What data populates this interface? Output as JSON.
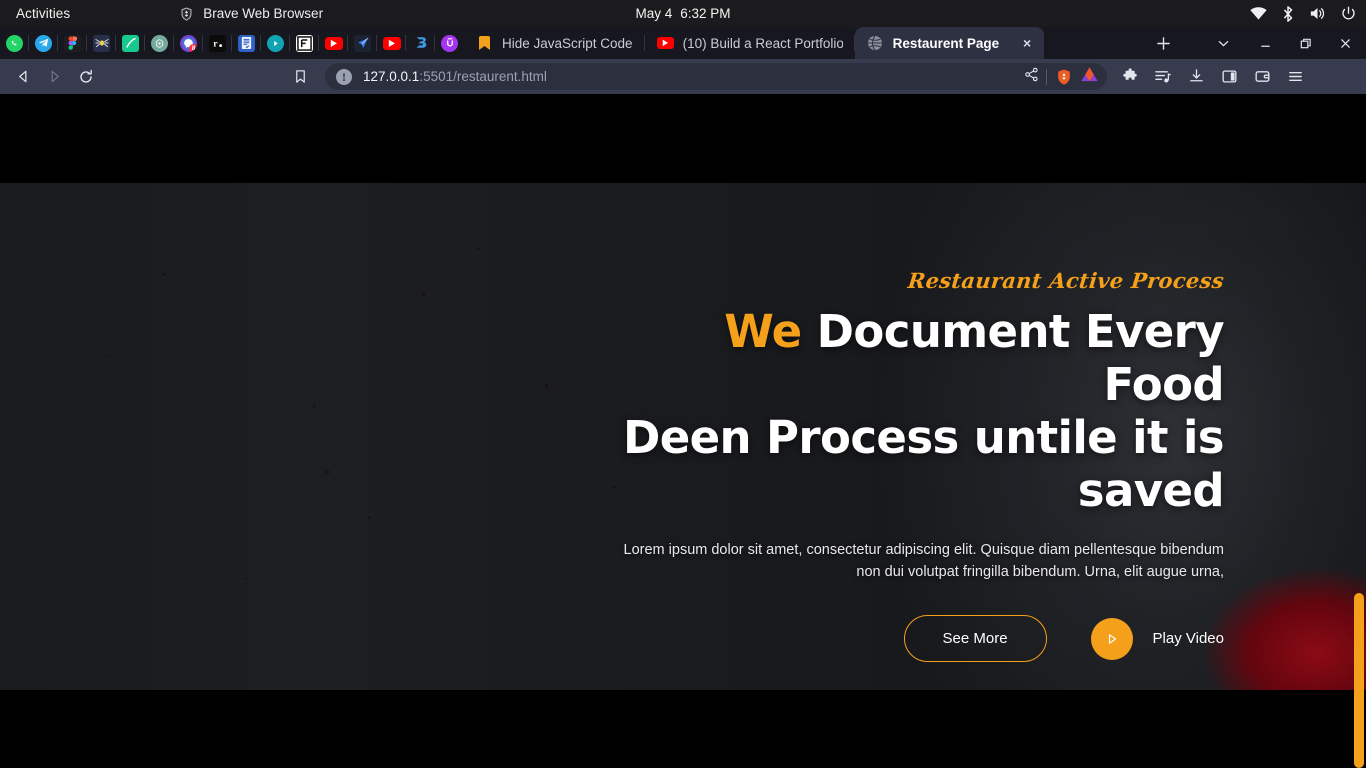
{
  "os_bar": {
    "activities": "Activities",
    "app_name": "Brave Web Browser",
    "app_icon": "brave-lion-icon",
    "date": "May 4",
    "time": "6:32 PM",
    "tray_icons": [
      "wifi-icon",
      "bluetooth-icon",
      "volume-icon",
      "power-icon"
    ]
  },
  "browser": {
    "pinned_tabs": [
      {
        "name": "whatsapp",
        "icon": "whatsapp-icon",
        "color": "#25D366"
      },
      {
        "name": "telegram",
        "icon": "telegram-icon",
        "color": "#29A9EB"
      },
      {
        "name": "figma",
        "icon": "figma-icon",
        "color": "#1e1e1e"
      },
      {
        "name": "spider",
        "icon": "bug-icon",
        "color": "#26304a"
      },
      {
        "name": "tick",
        "icon": "swoosh-icon",
        "color": "#17c98c"
      },
      {
        "name": "chatgpt",
        "icon": "openai-icon",
        "color": "#74aa9c"
      },
      {
        "name": "messenger",
        "icon": "messenger-badge-icon",
        "color": "#0084FF",
        "badge": "8"
      },
      {
        "name": "rapid",
        "icon": "r-dot-icon",
        "color": "#0b0b0b"
      },
      {
        "name": "notes",
        "icon": "notebook-icon",
        "color": "#2f62c4"
      },
      {
        "name": "player",
        "icon": "play-circle-icon",
        "color": "#12a3b4"
      },
      {
        "name": "flaticon",
        "icon": "f-frame-icon",
        "color": "#ffffff"
      },
      {
        "name": "youtube-1",
        "icon": "youtube-icon",
        "color": "#FF0000"
      },
      {
        "name": "arrow",
        "icon": "paper-plane-icon",
        "color": "#1c2333"
      },
      {
        "name": "youtube-2",
        "icon": "youtube-icon",
        "color": "#FF0000"
      },
      {
        "name": "bootstrap",
        "icon": "bootstrap-icon",
        "color": "#2f9ae0"
      },
      {
        "name": "udemy",
        "icon": "u-circle-icon",
        "color": "#a435f0"
      }
    ],
    "tabs": [
      {
        "title": "Hide JavaScript Code",
        "icon": "bookmark-tag-icon",
        "active": false
      },
      {
        "title": "(10) Build a React Portfolio",
        "icon": "youtube-icon",
        "active": false
      },
      {
        "title": "Restaurent Page",
        "icon": "globe-icon",
        "active": true
      }
    ],
    "tab_close_label": "×",
    "new_tab_label": "+",
    "tab_list_icon": "chevron-down-icon",
    "window_controls": [
      "minimize-icon",
      "restore-icon",
      "close-icon"
    ],
    "nav": {
      "back": "back-arrow-icon",
      "forward": "forward-arrow-icon",
      "reload": "reload-icon",
      "bookmark": "bookmark-icon"
    },
    "omnibox": {
      "info_icon": "not-secure-info-icon",
      "info_glyph": "!",
      "url_host": "127.0.0.1",
      "url_path": ":5501/restaurent.html",
      "share_icon": "share-icon",
      "shield_icon": "brave-shield-icon",
      "rewards_icon": "brave-rewards-triangle-icon"
    },
    "toolbar_icons": [
      "extensions-puzzle-icon",
      "playlist-icon",
      "downloads-icon",
      "sidebar-panel-icon",
      "wallet-icon",
      "main-menu-icon"
    ]
  },
  "hero": {
    "eyebrow": "Restaurant Active Process",
    "title_highlight": "We",
    "title_rest": " Document Every Food",
    "title_line2": "Deen Process untile it is saved",
    "description": "Lorem ipsum dolor sit amet, consectetur adipiscing elit. Quisque diam pellentesque bibendum non dui volutpat fringilla bibendum. Urna, elit augue urna,",
    "see_more_label": "See More",
    "play_video_label": "Play Video",
    "play_icon": "play-triangle-icon",
    "accent_color": "#f5a01b"
  },
  "scrollbar": {
    "thumb_color": "#f5a01b"
  }
}
